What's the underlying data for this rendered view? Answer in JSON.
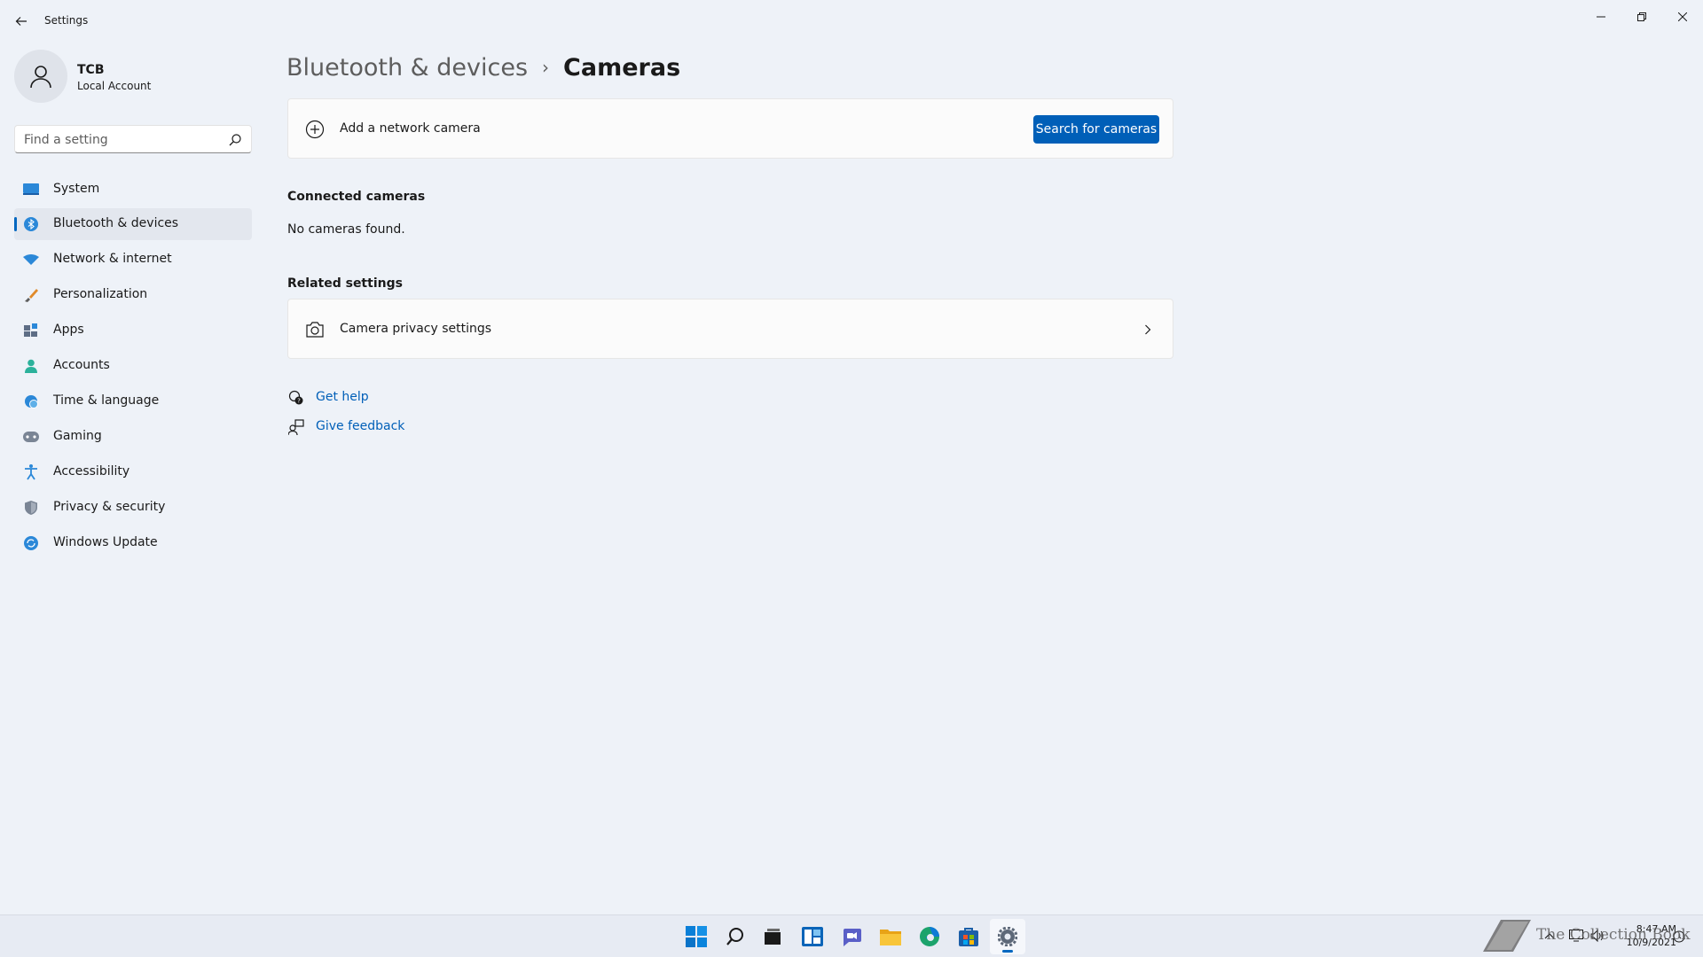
{
  "window": {
    "title": "Settings"
  },
  "user": {
    "name": "TCB",
    "account_type": "Local Account"
  },
  "search": {
    "placeholder": "Find a setting"
  },
  "sidebar": {
    "items": [
      {
        "label": "System",
        "icon": "system-icon",
        "active": false
      },
      {
        "label": "Bluetooth & devices",
        "icon": "bluetooth-icon",
        "active": true
      },
      {
        "label": "Network & internet",
        "icon": "wifi-icon",
        "active": false
      },
      {
        "label": "Personalization",
        "icon": "brush-icon",
        "active": false
      },
      {
        "label": "Apps",
        "icon": "apps-icon",
        "active": false
      },
      {
        "label": "Accounts",
        "icon": "person-icon",
        "active": false
      },
      {
        "label": "Time & language",
        "icon": "globe-clock-icon",
        "active": false
      },
      {
        "label": "Gaming",
        "icon": "gamepad-icon",
        "active": false
      },
      {
        "label": "Accessibility",
        "icon": "accessibility-icon",
        "active": false
      },
      {
        "label": "Privacy & security",
        "icon": "shield-icon",
        "active": false
      },
      {
        "label": "Windows Update",
        "icon": "update-icon",
        "active": false
      }
    ]
  },
  "breadcrumb": {
    "parent": "Bluetooth & devices",
    "separator": "›",
    "current": "Cameras"
  },
  "add_camera_card": {
    "label": "Add a network camera",
    "button_label": "Search for cameras"
  },
  "connected": {
    "heading": "Connected cameras",
    "empty_text": "No cameras found."
  },
  "related": {
    "heading": "Related settings",
    "camera_privacy_label": "Camera privacy settings"
  },
  "help_links": {
    "get_help": "Get help",
    "give_feedback": "Give feedback"
  },
  "taskbar": {
    "apps": [
      "start-icon",
      "search-icon",
      "task-view-icon",
      "widgets-icon",
      "chat-icon",
      "file-explorer-icon",
      "edge-icon",
      "store-icon",
      "settings-icon"
    ],
    "active_app": "settings-icon"
  },
  "clock": {
    "time": "8:47 AM",
    "date": "10/9/2021"
  },
  "watermark": {
    "text": "The Collection Book"
  },
  "colors": {
    "accent": "#005fb8",
    "background": "#eef2f8",
    "card": "#fbfbfb",
    "active_nav": "#e3e7ee"
  }
}
